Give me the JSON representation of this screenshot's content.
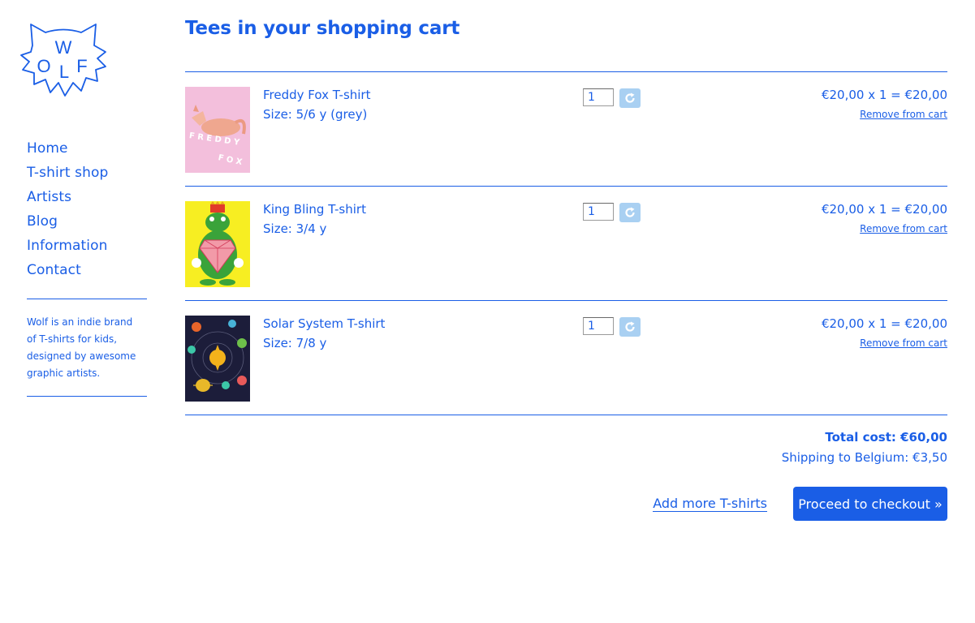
{
  "logo": {
    "letters": [
      "W",
      "O",
      "L",
      "F"
    ]
  },
  "nav": {
    "items": [
      {
        "label": "Home"
      },
      {
        "label": "T-shirt shop"
      },
      {
        "label": "Artists"
      },
      {
        "label": "Blog"
      },
      {
        "label": "Information"
      },
      {
        "label": "Contact"
      }
    ]
  },
  "blurb": "Wolf is an indie brand of T-shirts for kids, designed by awesome graphic artists.",
  "cart": {
    "title": "Tees in your shopping cart",
    "items": [
      {
        "name": "Freddy Fox T-shirt",
        "size": "Size: 5/6 y (grey)",
        "qty": "1",
        "price": "€20,00 x 1 = €20,00",
        "remove": "Remove from cart",
        "image": "fox-print-thumbnail"
      },
      {
        "name": "King Bling T-shirt",
        "size": "Size: 3/4 y",
        "qty": "1",
        "price": "€20,00 x 1 = €20,00",
        "remove": "Remove from cart",
        "image": "frog-king-thumbnail"
      },
      {
        "name": "Solar System T-shirt",
        "size": "Size: 7/8 y",
        "qty": "1",
        "price": "€20,00 x 1 = €20,00",
        "remove": "Remove from cart",
        "image": "solar-system-thumbnail"
      }
    ],
    "total": "Total cost: €60,00",
    "shipping": "Shipping to Belgium: €3,50",
    "add_more": "Add more T-shirts",
    "checkout": "Proceed to checkout »"
  },
  "colors": {
    "accent": "#1a5ee6",
    "refresh_button": "#a9d0f2"
  }
}
